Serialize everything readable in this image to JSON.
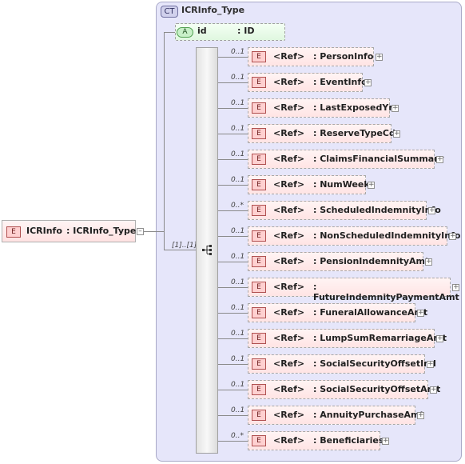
{
  "complex_type": {
    "badge": "CT",
    "name": "ICRInfo_Type"
  },
  "attribute": {
    "badge": "A",
    "name": "id",
    "type": ": ID"
  },
  "root": {
    "badge": "E",
    "name": "ICRInfo",
    "type": ": ICRInfo_Type",
    "expand": "–"
  },
  "sequence": {
    "multiplicity": "[1]..[1]"
  },
  "elements": [
    {
      "badge": "E",
      "ref": "<Ref>",
      "name": ": PersonInfo",
      "occ": "0..1",
      "expand": "+"
    },
    {
      "badge": "E",
      "ref": "<Ref>",
      "name": ": EventInfo",
      "occ": "0..1",
      "expand": "+"
    },
    {
      "badge": "E",
      "ref": "<Ref>",
      "name": ": LastExposedYr",
      "occ": "0..1",
      "expand": "+"
    },
    {
      "badge": "E",
      "ref": "<Ref>",
      "name": ": ReserveTypeCd",
      "occ": "0..1",
      "expand": "+"
    },
    {
      "badge": "E",
      "ref": "<Ref>",
      "name": ": ClaimsFinancialSummary",
      "occ": "0..1",
      "expand": "+"
    },
    {
      "badge": "E",
      "ref": "<Ref>",
      "name": ": NumWeeks",
      "occ": "0..1",
      "expand": "+"
    },
    {
      "badge": "E",
      "ref": "<Ref>",
      "name": ": ScheduledIndemnityInfo",
      "occ": "0..*",
      "expand": "+"
    },
    {
      "badge": "E",
      "ref": "<Ref>",
      "name": ": NonScheduledIndemnityInfo",
      "occ": "0..1",
      "expand": "+"
    },
    {
      "badge": "E",
      "ref": "<Ref>",
      "name": ": PensionIndemnityAmt",
      "occ": "0..1",
      "expand": "+"
    },
    {
      "badge": "E",
      "ref": "<Ref>",
      "name": ": FutureIndemnityPaymentAmt",
      "occ": "0..1",
      "expand": "+"
    },
    {
      "badge": "E",
      "ref": "<Ref>",
      "name": ": FuneralAllowanceAmt",
      "occ": "0..1",
      "expand": "+"
    },
    {
      "badge": "E",
      "ref": "<Ref>",
      "name": ": LumpSumRemarriageAmt",
      "occ": "0..1",
      "expand": "+"
    },
    {
      "badge": "E",
      "ref": "<Ref>",
      "name": ": SocialSecurityOffsetInd",
      "occ": "0..1",
      "expand": "+"
    },
    {
      "badge": "E",
      "ref": "<Ref>",
      "name": ": SocialSecurityOffsetAmt",
      "occ": "0..1",
      "expand": "+"
    },
    {
      "badge": "E",
      "ref": "<Ref>",
      "name": ": AnnuityPurchaseAmt",
      "occ": "0..1",
      "expand": "+"
    },
    {
      "badge": "E",
      "ref": "<Ref>",
      "name": ": Beneficiaries",
      "occ": "0..*",
      "expand": "+"
    }
  ]
}
